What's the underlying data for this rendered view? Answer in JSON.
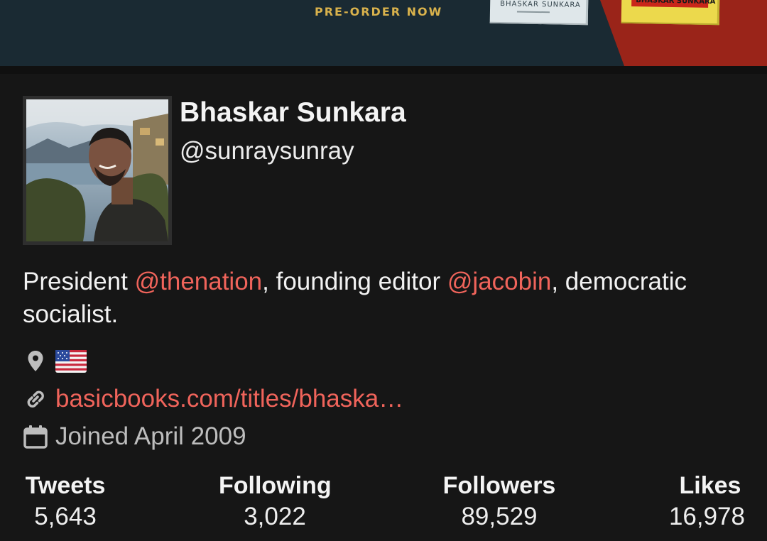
{
  "banner": {
    "cta": "PRE-ORDER NOW",
    "book_author_1": "BHASKAR SUNKARA",
    "book_author_2": "BHASKAR SUNKARA"
  },
  "profile": {
    "display_name": "Bhaskar Sunkara",
    "handle": "@sunraysunray",
    "bio": {
      "part1": "President ",
      "mention1": "@thenation",
      "part2": ", founding editor ",
      "mention2": "@jacobin",
      "part3": ", democratic socialist."
    },
    "location_icon": "location-pin-icon",
    "location_flag": "us-flag-icon",
    "website_icon": "link-icon",
    "website": "basicbooks.com/titles/bhaska…",
    "joined_icon": "calendar-icon",
    "joined": "Joined April 2009"
  },
  "stats": {
    "tweets_label": "Tweets",
    "tweets_value": "5,643",
    "following_label": "Following",
    "following_value": "3,022",
    "followers_label": "Followers",
    "followers_value": "89,529",
    "likes_label": "Likes",
    "likes_value": "16,978"
  },
  "colors": {
    "background": "#161616",
    "accent": "#f0645b",
    "banner": "#1a2a33",
    "banner_gold": "#d9b24c",
    "banner_red": "#9a2419"
  }
}
